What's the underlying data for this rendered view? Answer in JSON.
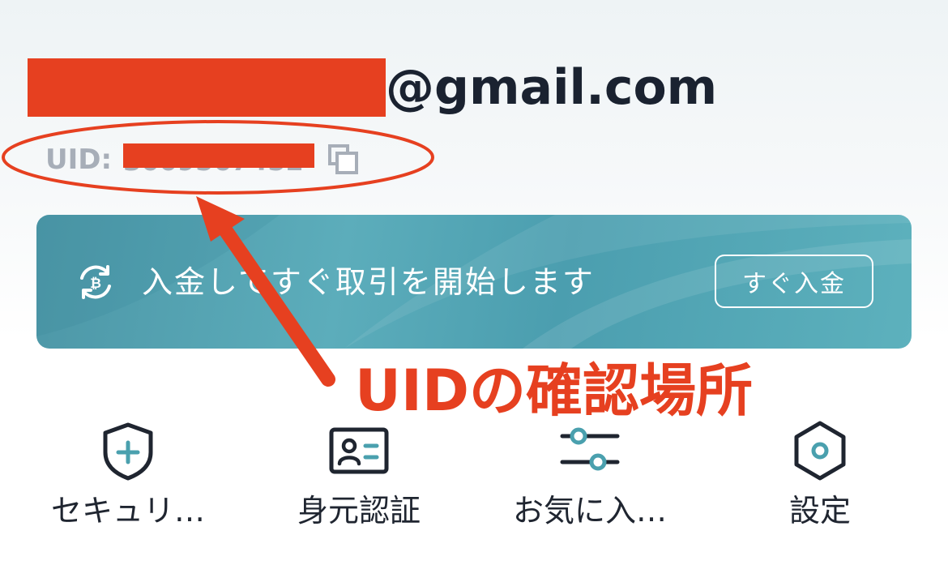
{
  "account": {
    "email_domain": "@gmail.com",
    "uid_label": "UID:",
    "uid_value": "3009567452"
  },
  "banner": {
    "text": "入金してすぐ取引を開始します",
    "button_label": "すぐ入金"
  },
  "annotation": {
    "text": "UIDの確認場所"
  },
  "menu": {
    "items": [
      {
        "label": "セキュリ…",
        "icon": "shield-plus-icon"
      },
      {
        "label": "身元認証",
        "icon": "id-card-icon"
      },
      {
        "label": "お気に入…",
        "icon": "sliders-icon"
      },
      {
        "label": "設定",
        "icon": "hexagon-settings-icon"
      }
    ]
  },
  "colors": {
    "redaction": "#e64020",
    "annotation": "#e64020",
    "banner_bg": "#55a7b6",
    "text_dark": "#1a2230",
    "text_muted": "#a7aeb8",
    "accent": "#4aa0ae"
  }
}
